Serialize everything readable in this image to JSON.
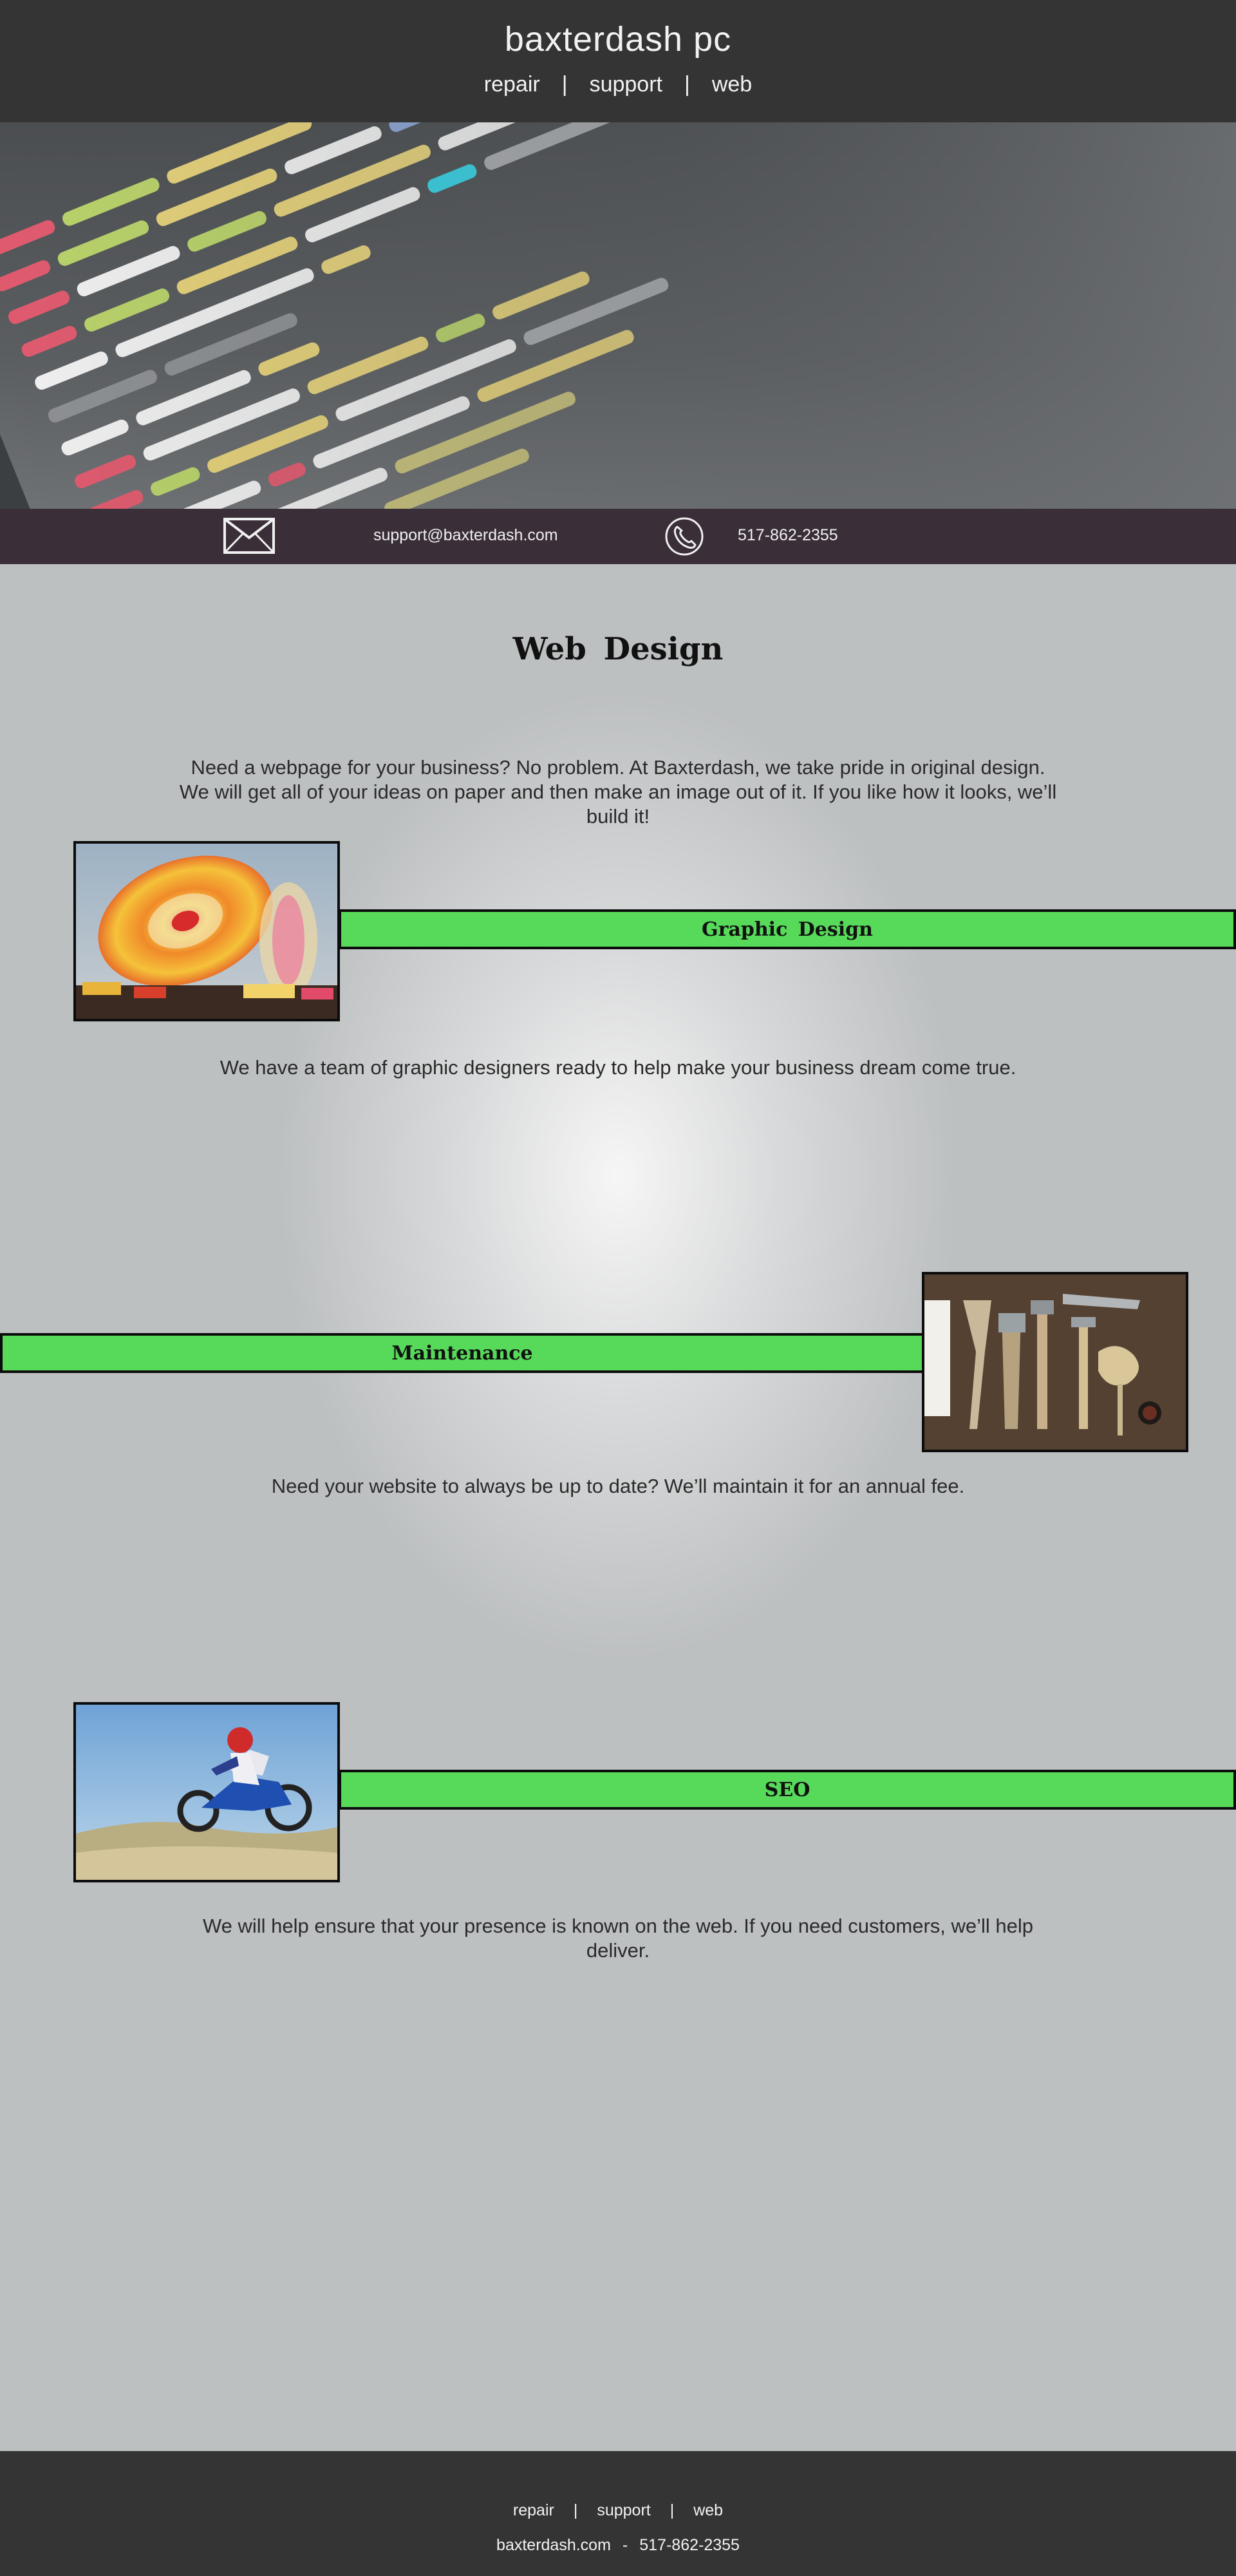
{
  "header": {
    "brand": "baxterdash pc",
    "nav": [
      {
        "label": "repair"
      },
      {
        "label": "support"
      },
      {
        "label": "web"
      }
    ],
    "separator": "|"
  },
  "contact": {
    "email": "support@baxterdash.com",
    "phone": "517-862-2355",
    "email_icon": "envelope-icon",
    "phone_icon": "phone-icon"
  },
  "main": {
    "heading": "Web  Design",
    "intro": "Need a webpage for your business? No problem. At Baxterdash, we take pride in original design. We will get all of your ideas on paper and then make an image out of it. If you like how it looks, we’ll build it!",
    "sections": [
      {
        "title": "Graphic  Design",
        "text": "We have a team of graphic designers ready to help make your business dream come true.",
        "image": "carnival-ride-photo"
      },
      {
        "title": "Maintenance",
        "text": "Need your website to always be up to date? We’ll maintain it for an annual fee.",
        "image": "tools-photo"
      },
      {
        "title": "SEO",
        "text": "We will help ensure that your presence is known on the web. If you need customers, we’ll help deliver.",
        "image": "motocross-photo"
      }
    ]
  },
  "footer": {
    "nav": [
      {
        "label": "repair"
      },
      {
        "label": "support"
      },
      {
        "label": "web"
      }
    ],
    "separator": "|",
    "site": "baxterdash.com",
    "dash": "-",
    "phone": "517-862-2355"
  },
  "colors": {
    "header_bg": "#343434",
    "contact_bg": "#3a2e39",
    "accent_bar": "#57d95a",
    "page_bg": "#bdc0c1"
  }
}
